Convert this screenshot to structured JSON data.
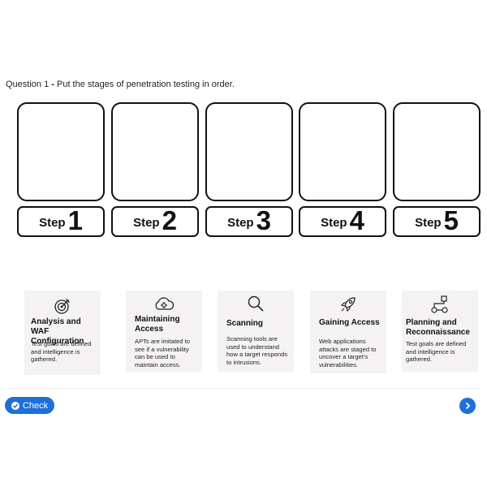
{
  "question": {
    "number": "Question 1",
    "separator": " - ",
    "text": "Put the stages of penetration testing in order."
  },
  "steps": [
    {
      "word": "Step",
      "number": "1"
    },
    {
      "word": "Step",
      "number": "2"
    },
    {
      "word": "Step",
      "number": "3"
    },
    {
      "word": "Step",
      "number": "4"
    },
    {
      "word": "Step",
      "number": "5"
    }
  ],
  "cards": [
    {
      "icon": "target-icon",
      "title": "Analysis and WAF Configuration",
      "description": "Test goals are defined and intelligence is gathered."
    },
    {
      "icon": "cloud-gear-icon",
      "title": "Maintaining Access",
      "description": "APTs are imitated to see if a vulnerability can be used to maintain access."
    },
    {
      "icon": "magnifier-icon",
      "title": "Scanning",
      "description": "Scanning tools are used to understand how a target responds to intrusions."
    },
    {
      "icon": "rocket-icon",
      "title": "Gaining Access",
      "description": "Web applications attacks are staged to uncover a target's vulnerabilities."
    },
    {
      "icon": "workflow-icon",
      "title": "Planning and Reconnaissance",
      "description": "Test goals are defined and intelligence is gathered."
    }
  ],
  "footer": {
    "check_label": "Check",
    "next_icon": "chevron-right-icon"
  },
  "colors": {
    "accent": "#1e6fd9",
    "card_bg": "#f5f2f3"
  }
}
